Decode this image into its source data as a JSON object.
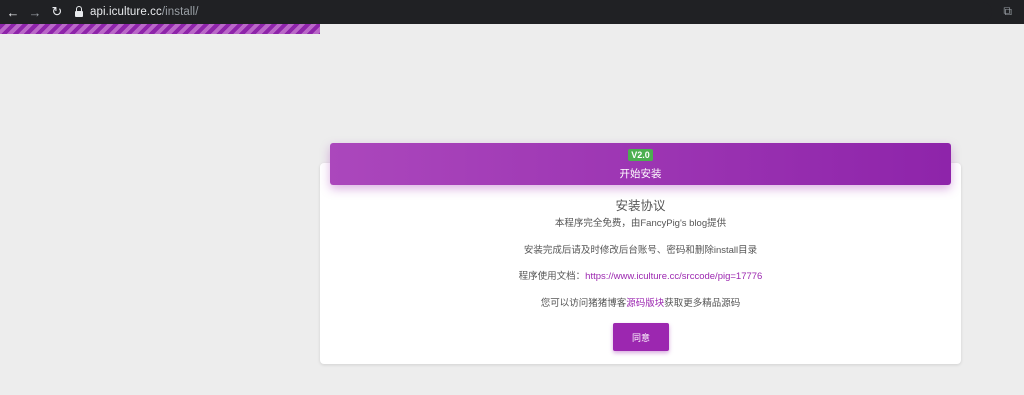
{
  "browser": {
    "back_icon": "arrow-left-icon",
    "forward_icon": "arrow-right-icon",
    "reload_icon": "reload-icon",
    "url_host": "api.iculture.cc",
    "url_path": "/install/"
  },
  "install": {
    "version_badge": "V2.0",
    "header_title": "开始安装",
    "agreement_title": "安装协议",
    "line1": "本程序完全免费，由FancyPig's blog提供",
    "line2": "安装完成后请及时修改后台账号、密码和删除install目录",
    "line3_label": "程序使用文档：",
    "line3_link": "https://www.iculture.cc/srccode/pig=17776",
    "line4_prefix": "您可以访问猪猪博客",
    "line4_link": "源码版块",
    "line4_suffix": "获取更多精品源码",
    "agree_button": "同意"
  },
  "colors": {
    "accent": "#9c27b0",
    "badge": "#4caf50"
  }
}
